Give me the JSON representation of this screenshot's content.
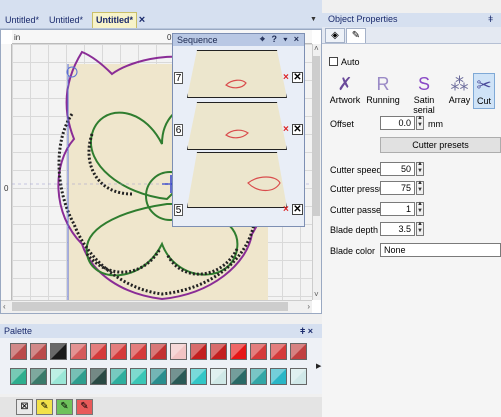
{
  "tabs": [
    {
      "label": "Untitled*",
      "active": false
    },
    {
      "label": "Untitled*",
      "active": false
    },
    {
      "label": "Untitled*",
      "active": true
    }
  ],
  "tab_close_glyph": "×",
  "tab_dropdown_glyph": "▼",
  "ruler": {
    "unit": "in",
    "top_mark": "0",
    "left_mark": "0"
  },
  "sequence": {
    "title": "Sequence",
    "title_icons": "⌖ ? ▾ ×",
    "items": [
      {
        "number": "7",
        "thread_color": "#d94c4c"
      },
      {
        "number": "6",
        "thread_color": "#d94c4c"
      },
      {
        "number": "5",
        "thread_color": "#d94c4c"
      }
    ],
    "remove_glyph": "×"
  },
  "properties": {
    "title": "Object Properties",
    "pin_glyph": "ǂ",
    "tab_icons": [
      "fill-tab-icon",
      "pen-tab-icon"
    ],
    "auto_label": "Auto",
    "auto_checked": false,
    "modes": [
      {
        "label": "Artwork",
        "icon": "artwork-icon",
        "glyph": "✗",
        "active": false
      },
      {
        "label": "Running",
        "icon": "running-icon",
        "glyph": "R",
        "active": false
      },
      {
        "label": "Satin serial",
        "icon": "satin-serial-icon",
        "glyph": "S",
        "active": false
      },
      {
        "label": "Array",
        "icon": "array-icon",
        "glyph": "⁂",
        "active": false
      },
      {
        "label": "Cut",
        "icon": "cut-icon",
        "glyph": "✂",
        "active": true
      }
    ],
    "offset": {
      "label": "Offset",
      "value": "0.0",
      "unit": "mm"
    },
    "presets_label": "Cutter presets",
    "cutter_speed": {
      "label": "Cutter speed",
      "value": "50"
    },
    "cutter_pressure": {
      "label": "Cutter pressure",
      "value": "75"
    },
    "cutter_passes": {
      "label": "Cutter passes",
      "value": "1"
    },
    "blade_depth": {
      "label": "Blade depth",
      "value": "3.5"
    },
    "blade_color": {
      "label": "Blade color",
      "value": "None"
    }
  },
  "palette": {
    "title": "Palette",
    "header_icons": "ǂ ×",
    "row1": [
      "#b94a4a",
      "#b94a4a",
      "#1a1a1a",
      "#d45a5a",
      "#d43a3a",
      "#d43a3a",
      "#d43a3a",
      "#c23030",
      "#f2c4c4",
      "#c21e1e",
      "#c21e1e",
      "#e51616",
      "#d43a3a",
      "#d43a3a",
      "#c04040"
    ],
    "row2": [
      "#2eae8e",
      "#3a7a6a",
      "#9ae6d6",
      "#2e9e8e",
      "#2a4a44",
      "#2eae9e",
      "#3ac6b6",
      "#2a8e8e",
      "#2a5a56",
      "#32c6c6",
      "#cfe8e6",
      "#2a6a66",
      "#32a6a6",
      "#2ab6c6",
      "#d0e8e8"
    ],
    "tools": [
      {
        "icon": "no-color-tool-icon",
        "glyph": "⊠",
        "bg": "#e9e9e9"
      },
      {
        "icon": "pen-tool-icon",
        "glyph": "✎",
        "bg": "#f2e24a"
      },
      {
        "icon": "pen-green-tool-icon",
        "glyph": "✎",
        "bg": "#6ec25c"
      },
      {
        "icon": "pen-red-tool-icon",
        "glyph": "✎",
        "bg": "#e85a5a"
      }
    ]
  }
}
